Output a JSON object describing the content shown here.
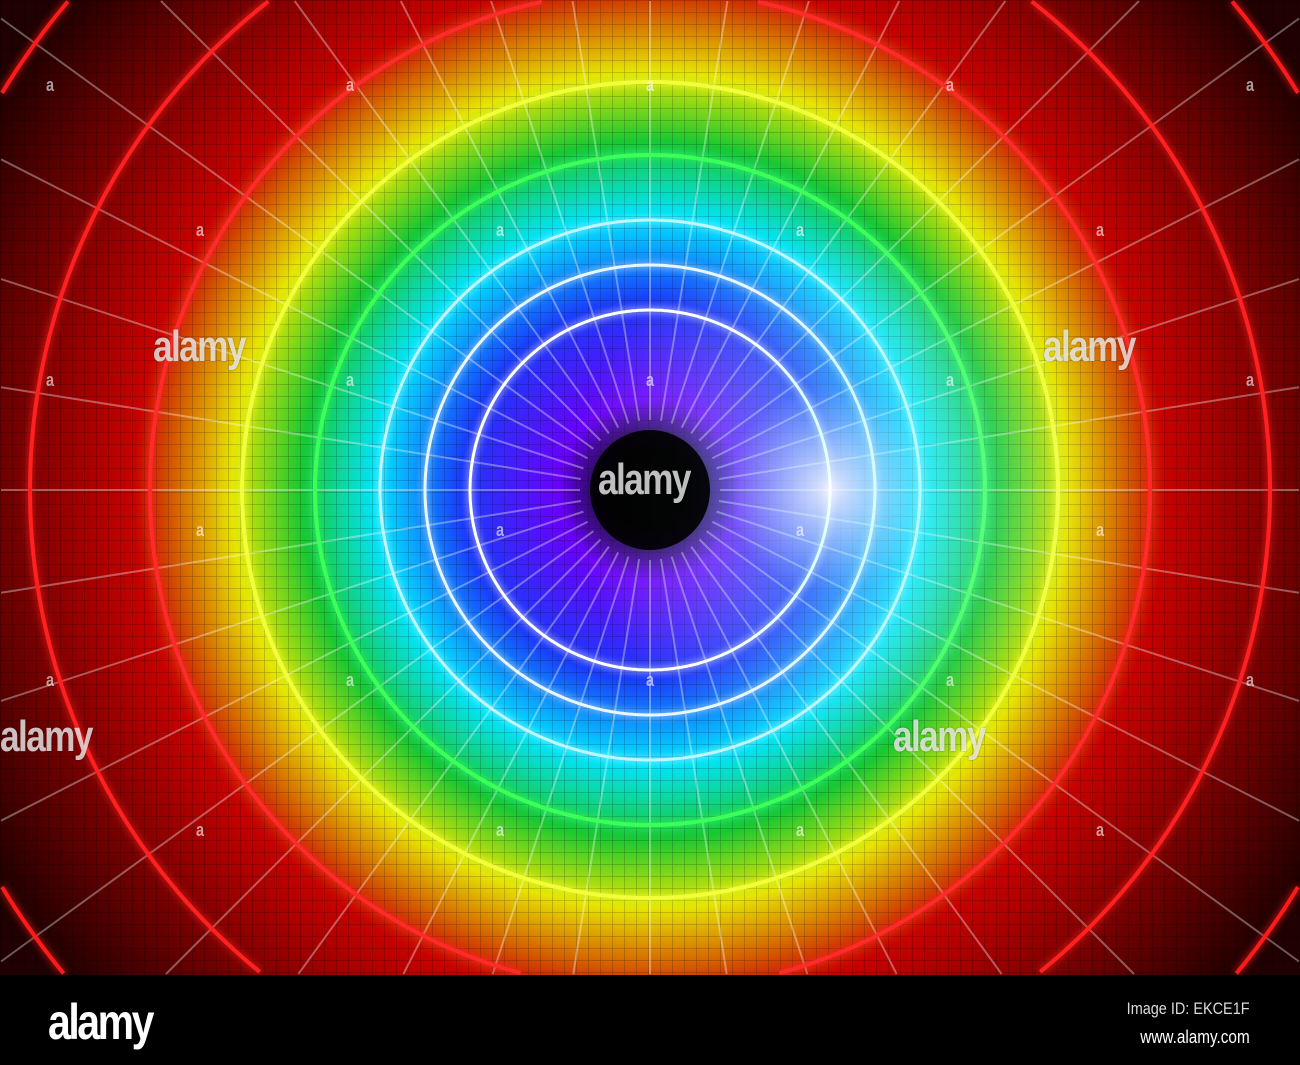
{
  "watermark": {
    "text": "alamy",
    "small_text": "a"
  },
  "footer": {
    "logo": "alamy",
    "image_id": "Image ID: EKCE1F",
    "url": "www.alamy.com"
  },
  "colors": {
    "background": "#000000",
    "ring_colors": [
      "#ffffff",
      "#e8f6ff",
      "#bff7ff",
      "#3cff5a",
      "#f2ff3a",
      "#ff2a2a",
      "#ff2020",
      "#ff1a1a"
    ],
    "glow_center": "#6a00ff",
    "glow_blue": "#1a3cff",
    "glow_cyan": "#00e5ff",
    "glow_green": "#19c832",
    "glow_yellow": "#e6e600",
    "glow_red": "#c80000"
  }
}
